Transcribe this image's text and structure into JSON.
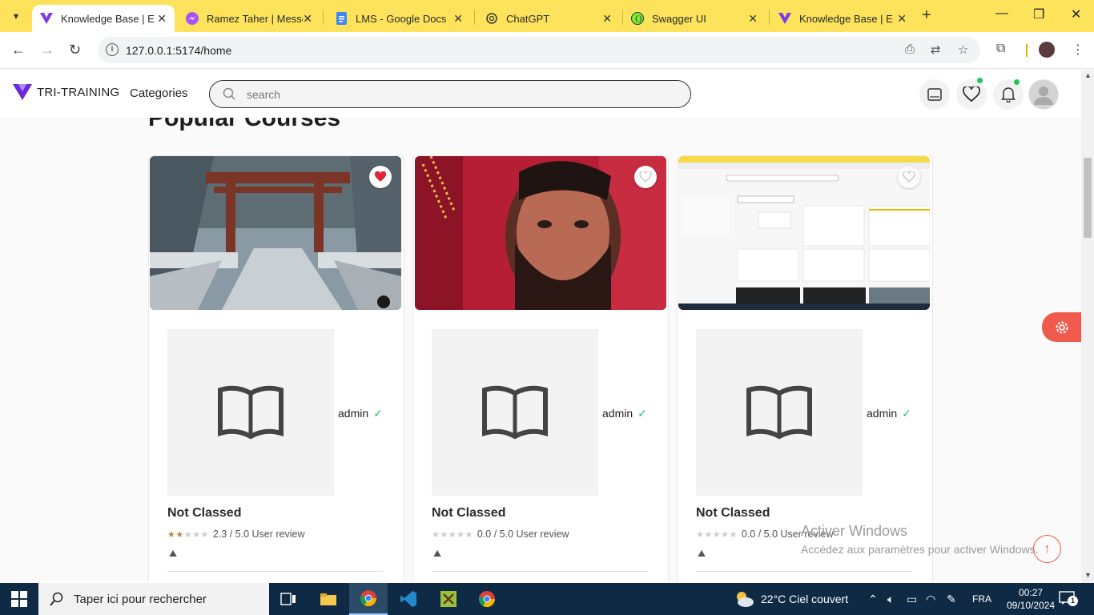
{
  "browser": {
    "tabs": [
      {
        "title": "Knowledge Base | E Lea",
        "icon": "v-logo-icon",
        "active": true
      },
      {
        "title": "Ramez Taher | Messenger",
        "icon": "messenger-icon",
        "active": false
      },
      {
        "title": "LMS - Google Docs",
        "icon": "docs-icon",
        "active": false
      },
      {
        "title": "ChatGPT",
        "icon": "chatgpt-icon",
        "active": false
      },
      {
        "title": "Swagger UI",
        "icon": "swagger-icon",
        "active": false
      },
      {
        "title": "Knowledge Base | E Lea",
        "icon": "v-logo-icon",
        "active": false
      }
    ],
    "url": "127.0.0.1:5174/home"
  },
  "app": {
    "brand": "TRI-TRAINING",
    "categories_label": "Categories",
    "search_placeholder": "search"
  },
  "section": {
    "title": "Popular Courses"
  },
  "courses": [
    {
      "author": "admin",
      "title": "Not Classed",
      "rating_text": "2.3 / 5.0 User review",
      "rating": 2.3,
      "favorited": true,
      "thumbnail": "snowy-shrine-photo"
    },
    {
      "author": "admin",
      "title": "Not Classed",
      "rating_text": "0.0 / 5.0 User review",
      "rating": 0.0,
      "favorited": false,
      "thumbnail": "man-portrait-photo"
    },
    {
      "author": "admin",
      "title": "Not Classed",
      "rating_text": "0.0 / 5.0 User review",
      "rating": 0.0,
      "favorited": false,
      "thumbnail": "app-screenshot"
    }
  ],
  "watermark": {
    "line1": "Activer Windows",
    "line2": "Accédez aux paramètres pour activer Windows."
  },
  "taskbar": {
    "search_text": "Taper ici pour rechercher",
    "weather": "22°C  Ciel couvert",
    "language": "FRA",
    "time": "00:27",
    "date": "09/10/2024",
    "notifications": "1"
  },
  "colors": {
    "accent": "#ef5a4c",
    "tabbar": "#fde35c",
    "brand_purple": "#6d28d9",
    "star": "#c2873a"
  }
}
